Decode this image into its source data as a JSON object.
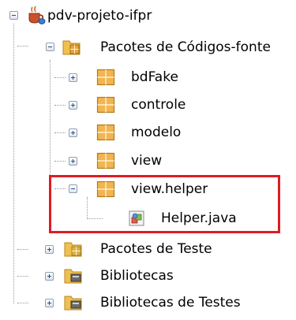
{
  "tree": {
    "project": {
      "label": "pdv-projeto-ifpr",
      "icon": "java-coffee-cup-icon"
    },
    "source_packages": {
      "label": "Pacotes de Códigos-fonte",
      "icon": "source-packages-folder-icon"
    },
    "packages": [
      {
        "label": "bdFake",
        "icon": "package-icon"
      },
      {
        "label": "controle",
        "icon": "package-icon"
      },
      {
        "label": "modelo",
        "icon": "package-icon"
      },
      {
        "label": "view",
        "icon": "package-icon"
      }
    ],
    "selected_package": {
      "label": "view.helper",
      "icon": "package-icon"
    },
    "file": {
      "label": "Helper.java",
      "icon": "java-file-icon"
    },
    "test_packages": {
      "label": "Pacotes de Teste",
      "icon": "test-packages-folder-icon"
    },
    "libraries": {
      "label": "Bibliotecas",
      "icon": "library-folder-icon"
    },
    "test_libraries": {
      "label": "Bibliotecas de Testes",
      "icon": "library-folder-icon"
    }
  },
  "colors": {
    "highlight": "#e01b24",
    "package": "#e8a33a",
    "folder": "#e9b949"
  }
}
